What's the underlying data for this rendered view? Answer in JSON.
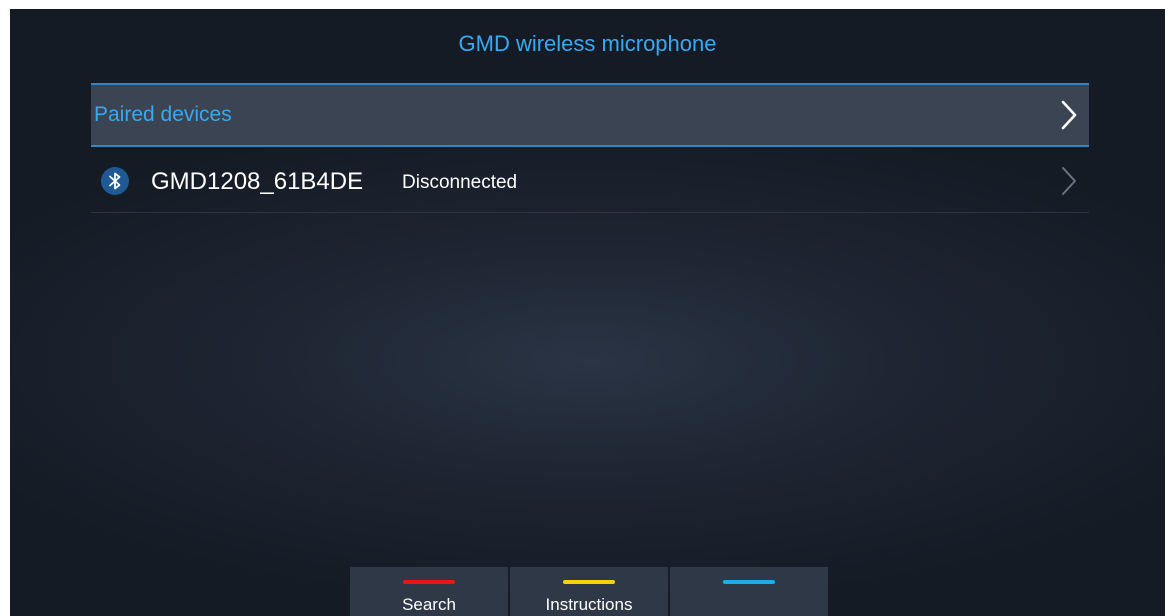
{
  "header": {
    "title": "GMD wireless microphone"
  },
  "paired_section": {
    "label": "Paired devices",
    "icon": "chevron-right-icon"
  },
  "devices": [
    {
      "name": "GMD1208_61B4DE",
      "status": "Disconnected",
      "icon": "bluetooth-icon"
    }
  ],
  "softkeys": [
    {
      "label": "Search",
      "color": "#e8151b"
    },
    {
      "label": "Instructions",
      "color": "#f5d20a"
    },
    {
      "label": "",
      "color": "#19b0e6"
    }
  ],
  "colors": {
    "accent": "#3aa8f0",
    "selected_row": "#3a4453",
    "background": "#1e2633",
    "bluetooth_badge": "#1f5a94"
  }
}
